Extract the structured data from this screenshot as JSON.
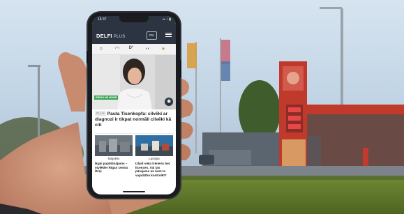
{
  "phone": {
    "status": {
      "time": "16:37",
      "icons": "▪▪ ◔ ▮"
    },
    "app": {
      "logo": "DELFI",
      "logo_suffix": "PLUS",
      "top_button": "RU",
      "menu_icon": "hamburger-menu-icon"
    },
    "icons_row": [
      "search-icon",
      "user-icon",
      "degree-icon",
      "headphones-icon",
      "avatar-icon"
    ],
    "icons_row_glyphs": {
      "search": "⌕",
      "user": "◠",
      "degree": "D°",
      "headphones": "◖◗",
      "avatar": "●"
    },
    "hero": {
      "badge": "RENDI HE MUNE",
      "camera_icon": "camera-icon",
      "camera_glyph": "◉"
    },
    "headline": {
      "badge": "PLUS",
      "text": "Paula Tisenkopfa: cilvēki ar diagnozi ir tikpat normāli cilvēki kā citi"
    },
    "cards": [
      {
        "tag": "Mājoklis",
        "text": "Ikgāi papildinājums – mylēklet Rīgas centra lērņi"
      },
      {
        "tag": "Latvijas",
        "text": "Izlaid viela treneris bez licences. Vai tas pārejams un kam to vajadzību kontrolēt?"
      }
    ]
  },
  "colors": {
    "sky": "#c3d7e8",
    "grass": "#5f7a2a",
    "station_red": "#c0392b",
    "phone_body": "#1a1b1e",
    "app_header": "#2b3440"
  }
}
